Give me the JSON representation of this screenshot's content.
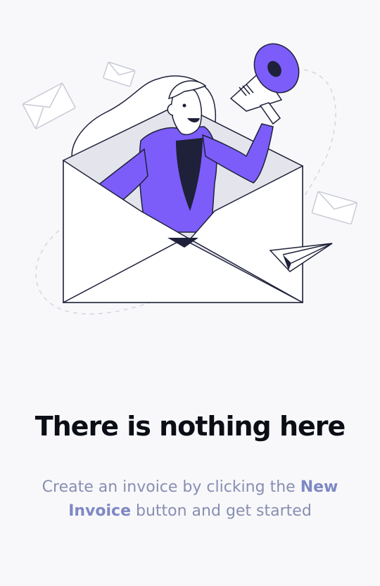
{
  "empty_state": {
    "title": "There is nothing here",
    "description_before": "Create an invoice by clicking the",
    "description_emphasis": "New Invoice",
    "description_after": "button and get started",
    "illustration": "woman-with-megaphone-in-envelope"
  },
  "colors": {
    "background": "#f8f8fb",
    "accent": "#7c5dfa",
    "title": "#0c0e16",
    "description": "#888eb0",
    "emphasis": "#7e88c3"
  }
}
